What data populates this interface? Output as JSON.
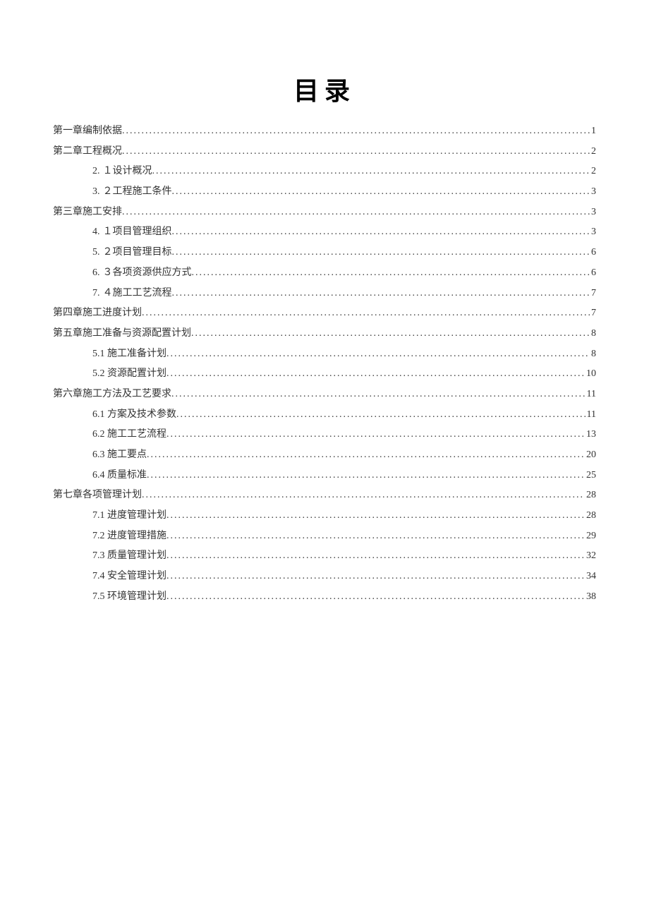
{
  "title": "目录",
  "toc": [
    {
      "level": 0,
      "num": "",
      "label": "第一章编制依据",
      "page": "1"
    },
    {
      "level": 0,
      "num": "",
      "label": "第二章工程概况",
      "page": "2"
    },
    {
      "level": 1,
      "num": "2.",
      "label": "１设计概况 ",
      "page": "2"
    },
    {
      "level": 1,
      "num": "3.",
      "label": "２工程施工条件 ",
      "page": "3"
    },
    {
      "level": 0,
      "num": "",
      "label": "第三章施工安排",
      "page": "3"
    },
    {
      "level": 1,
      "num": "4.",
      "label": "１项目管理组织",
      "page": "3"
    },
    {
      "level": 1,
      "num": "5.",
      "label": "２项目管理目标",
      "page": "6"
    },
    {
      "level": 1,
      "num": "6.",
      "label": "３各项资源供应方式",
      "page": "6"
    },
    {
      "level": 1,
      "num": "7.",
      "label": "４施工工艺流程",
      "page": "7"
    },
    {
      "level": 0,
      "num": "",
      "label": "第四章施工进度计划",
      "page": "7"
    },
    {
      "level": 0,
      "num": "",
      "label": "第五章施工准备与资源配置计划",
      "page": "8"
    },
    {
      "level": 1,
      "num": "",
      "label": "5.1 施工准备计划",
      "page": "8"
    },
    {
      "level": 1,
      "num": "",
      "label": "5.2 资源配置计划",
      "page": "10"
    },
    {
      "level": 0,
      "num": "",
      "label": "第六章施工方法及工艺要求",
      "page": "11"
    },
    {
      "level": 1,
      "num": "",
      "label": "6.1 方案及技术参数",
      "page": "11"
    },
    {
      "level": 1,
      "num": "",
      "label": "6.2 施工工艺流程",
      "page": "13"
    },
    {
      "level": 1,
      "num": "",
      "label": "6.3 施工要点",
      "page": "20"
    },
    {
      "level": 1,
      "num": "",
      "label": "6.4 质量标准",
      "page": "25"
    },
    {
      "level": 0,
      "num": "",
      "label": "第七章各项管理计划",
      "page": "28"
    },
    {
      "level": 1,
      "num": "",
      "label": "7.1 进度管理计划",
      "page": "28"
    },
    {
      "level": 1,
      "num": "",
      "label": "7.2 进度管理措施",
      "page": "29"
    },
    {
      "level": 1,
      "num": "",
      "label": "7.3 质量管理计划",
      "page": "32"
    },
    {
      "level": 1,
      "num": "",
      "label": "7.4 安全管理计划",
      "page": "34"
    },
    {
      "level": 1,
      "num": "",
      "label": "7.5 环境管理计划 ",
      "page": "38"
    }
  ]
}
